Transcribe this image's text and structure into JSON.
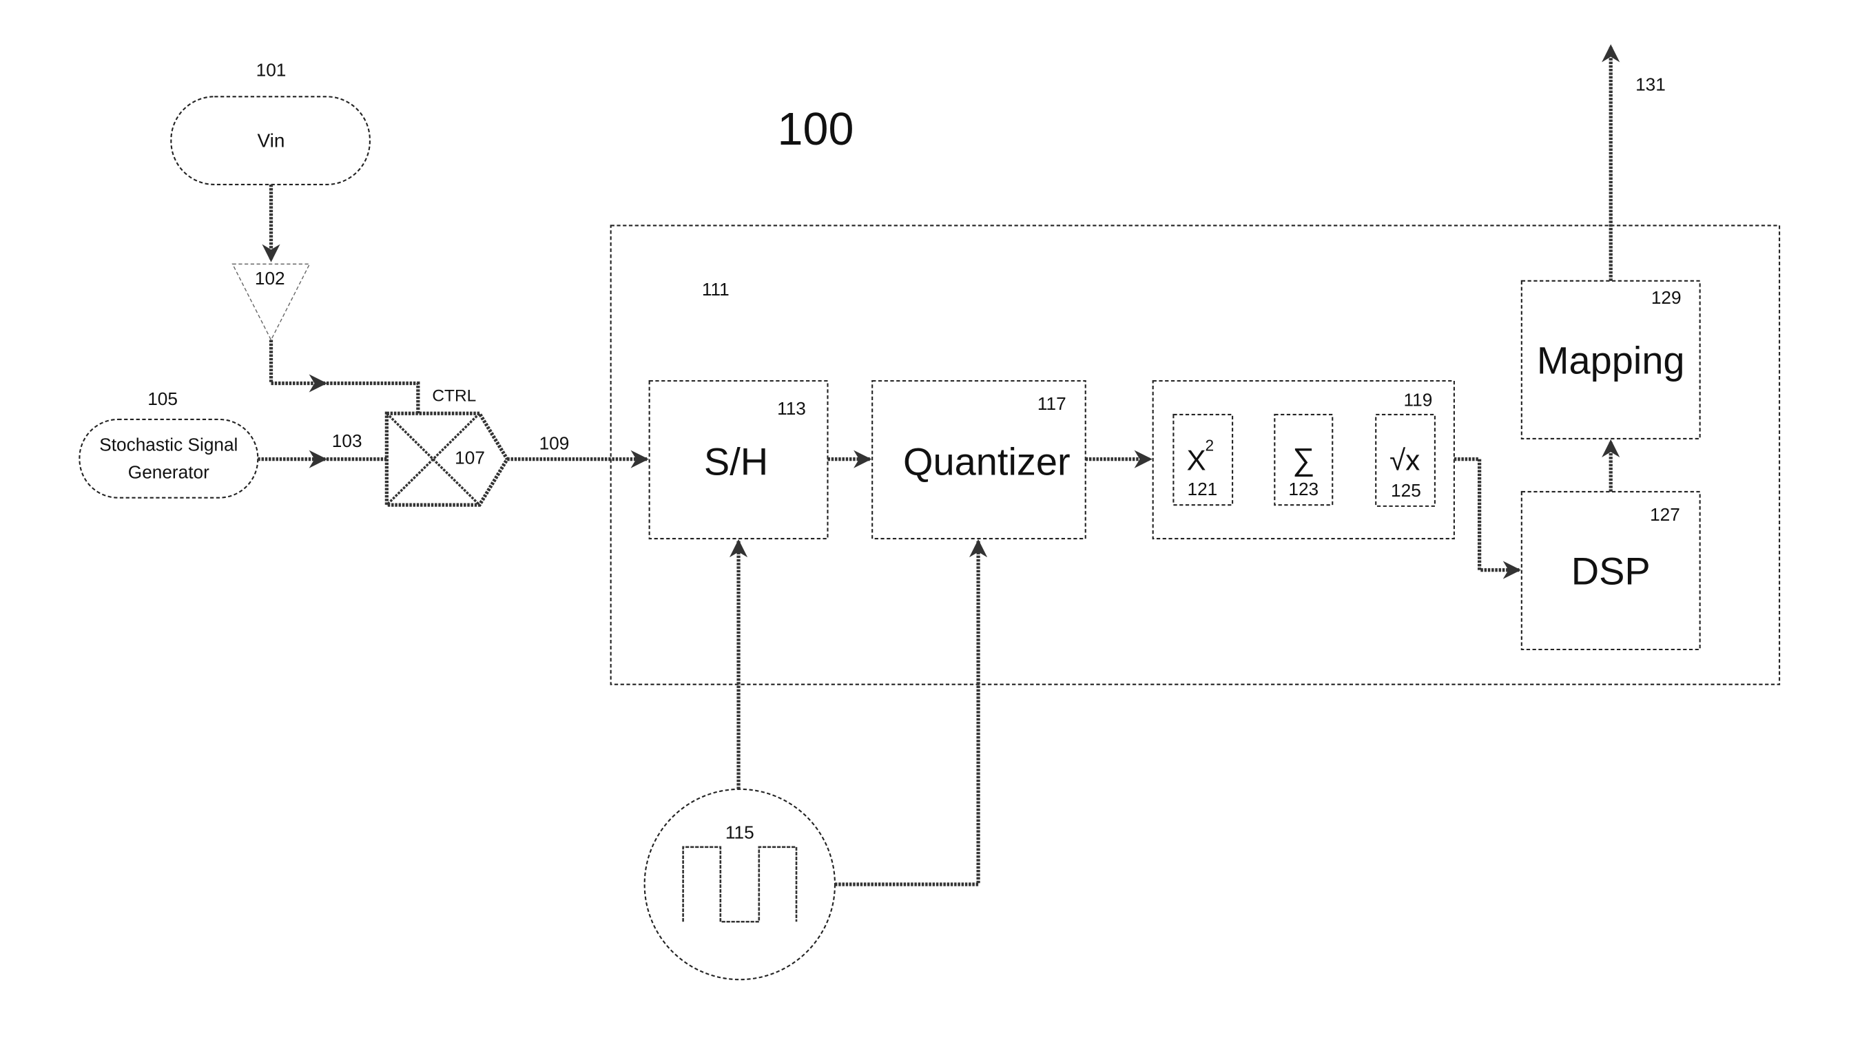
{
  "diagram": {
    "title": "100",
    "nodes": {
      "vin": {
        "ref": "101",
        "label": "Vin"
      },
      "amplifier": {
        "ref": "102"
      },
      "generator": {
        "ref": "105",
        "label_line1": "Stochastic Signal",
        "label_line2": "Generator"
      },
      "signal_103": {
        "ref": "103"
      },
      "mixer": {
        "ref": "107",
        "ctrl_label": "CTRL"
      },
      "signal_109": {
        "ref": "109"
      },
      "adc_block": {
        "ref": "111"
      },
      "sample_hold": {
        "ref": "113",
        "label": "S/H"
      },
      "clock": {
        "ref": "115"
      },
      "quantizer": {
        "ref": "117",
        "label": "Quantizer"
      },
      "rms_block": {
        "ref": "119"
      },
      "square": {
        "ref": "121",
        "label": "X",
        "superscript": "2"
      },
      "sum": {
        "ref": "123",
        "label": "∑"
      },
      "sqrt": {
        "ref": "125",
        "label": "√x"
      },
      "dsp": {
        "ref": "127",
        "label": "DSP"
      },
      "mapping": {
        "ref": "129",
        "label": "Mapping"
      },
      "output": {
        "ref": "131"
      }
    }
  }
}
